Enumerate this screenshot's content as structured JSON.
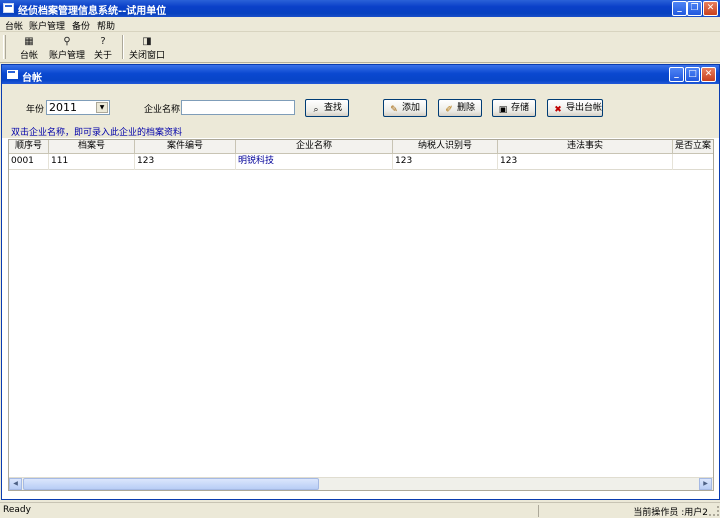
{
  "window": {
    "title": "经侦档案管理信息系统--试用单位"
  },
  "menubar": {
    "items": [
      "台帐",
      "账户管理",
      "备份",
      "帮助"
    ]
  },
  "toolbar": {
    "buttons": [
      {
        "label": "台帐",
        "icon": "ledger-icon"
      },
      {
        "label": "账户管理",
        "icon": "account-icon"
      },
      {
        "label": "关于",
        "icon": "help-icon"
      },
      {
        "label": "关闭窗口",
        "icon": "close-window-icon"
      }
    ]
  },
  "child_window": {
    "title": "台帐"
  },
  "form": {
    "year_label": "年份",
    "year_value": "2011",
    "company_label": "企业名称",
    "company_value": "",
    "search_label": "查找",
    "add_label": "添加",
    "delete_label": "删除",
    "save_label": "存储",
    "export_label": "导出台帐"
  },
  "hint": "双击企业名称，即可录入此企业的档案资料",
  "table": {
    "columns": [
      "顺序号",
      "档案号",
      "案件编号",
      "企业名称",
      "纳税人识别号",
      "违法事实",
      "是否立案"
    ],
    "rows": [
      [
        "0001",
        "111",
        "123",
        "明锐科技",
        "123",
        "123",
        ""
      ]
    ]
  },
  "statusbar": {
    "left": "Ready",
    "right": "当前操作员 :用户2"
  }
}
